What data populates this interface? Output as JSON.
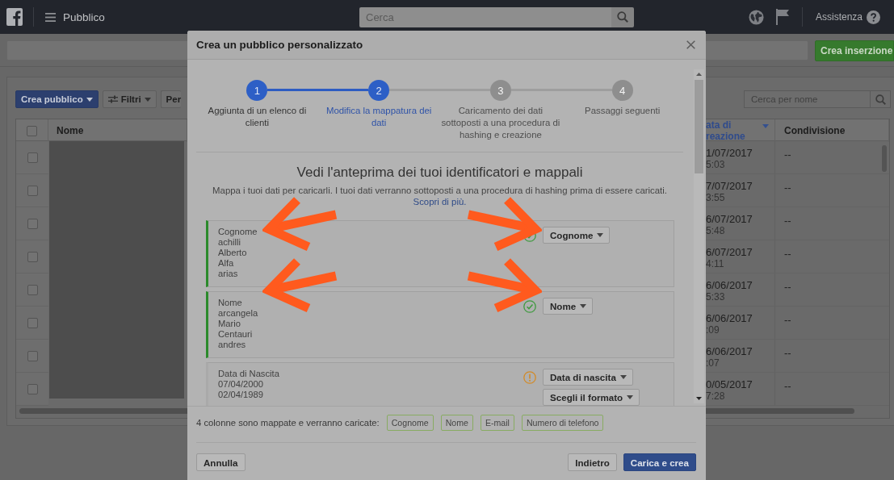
{
  "top_bar": {
    "title": "Pubblico",
    "search": {
      "placeholder": "Cerca"
    },
    "help_label": "Assistenza"
  },
  "action_bar": {
    "create_ad_button": "Crea inserzione"
  },
  "toolbar": {
    "buttons": [
      {
        "label": "Crea pubblico",
        "kind": "primary"
      },
      {
        "label": "Filtri",
        "kind": "filter"
      },
      {
        "label": "Per",
        "kind": "plain"
      }
    ],
    "search": {
      "placeholder": "Cerca per nome"
    }
  },
  "table": {
    "select_all_checked": false,
    "columns": [
      {
        "label": "Nome",
        "sorted": false
      },
      {
        "label": "ata di reazione",
        "sorted": true
      },
      {
        "label": "Condivisione",
        "sorted": false
      }
    ],
    "rows": [
      {
        "checked": false,
        "date": "1/07/2017",
        "time": "5:03",
        "sharing": "--"
      },
      {
        "checked": false,
        "date": "7/07/2017",
        "time": "3:55",
        "sharing": "--"
      },
      {
        "checked": false,
        "date": "6/07/2017",
        "time": "5:48",
        "sharing": "--"
      },
      {
        "checked": false,
        "date": "6/07/2017",
        "time": "4:11",
        "sharing": "--"
      },
      {
        "checked": false,
        "date": "6/06/2017",
        "time": "5:33",
        "sharing": "--"
      },
      {
        "checked": false,
        "date": "6/06/2017",
        "time": ":09",
        "sharing": "--"
      },
      {
        "checked": false,
        "date": "6/06/2017",
        "time": ":07",
        "sharing": "--"
      },
      {
        "checked": false,
        "date": "0/05/2017",
        "time": "7:28",
        "sharing": "--"
      }
    ]
  },
  "modal": {
    "title": "Crea un pubblico personalizzato",
    "steps": [
      {
        "number": "1",
        "label": "Aggiunta di un elenco di clienti",
        "selected": false
      },
      {
        "number": "2",
        "label": "Modifica la mappatura dei dati",
        "selected": true
      },
      {
        "number": "3",
        "label": "Caricamento dei dati sottoposti a una procedura di hashing e creazione",
        "selected": false
      },
      {
        "number": "4",
        "label": "Passaggi seguenti",
        "selected": false
      }
    ],
    "heading": "Vedi l'anteprima dei tuoi identificatori e mappali",
    "description": "Mappa i tuoi dati per caricarli. I tuoi dati verranno sottoposti a una procedura di hashing prima di essere caricati.",
    "learn_more_link": "Scopri di più.",
    "mappings": [
      {
        "kind": "mapped",
        "header": "Cognome",
        "samples": [
          "achilli",
          "Alberto",
          "Alfa",
          "arias"
        ],
        "fields": [
          "Cognome"
        ]
      },
      {
        "kind": "mapped",
        "header": "Nome",
        "samples": [
          "arcangela",
          "Mario",
          "Centauri",
          "andres"
        ],
        "fields": [
          "Nome"
        ]
      },
      {
        "kind": "warning",
        "header": "Data di Nascita",
        "samples": [
          "07/04/2000",
          "02/04/1989"
        ],
        "fields": [
          "Data di nascita",
          "Scegli il formato"
        ]
      }
    ],
    "summary": {
      "text": "4 colonne sono mappate e verranno caricate:",
      "tags": [
        "Cognome",
        "Nome",
        "E-mail",
        "Numero di telefono"
      ]
    },
    "buttons": [
      {
        "label": "Annulla",
        "kind": "secondary"
      },
      {
        "label": "Indietro",
        "kind": "secondary"
      },
      {
        "label": "Carica e crea",
        "kind": "primary"
      }
    ]
  }
}
